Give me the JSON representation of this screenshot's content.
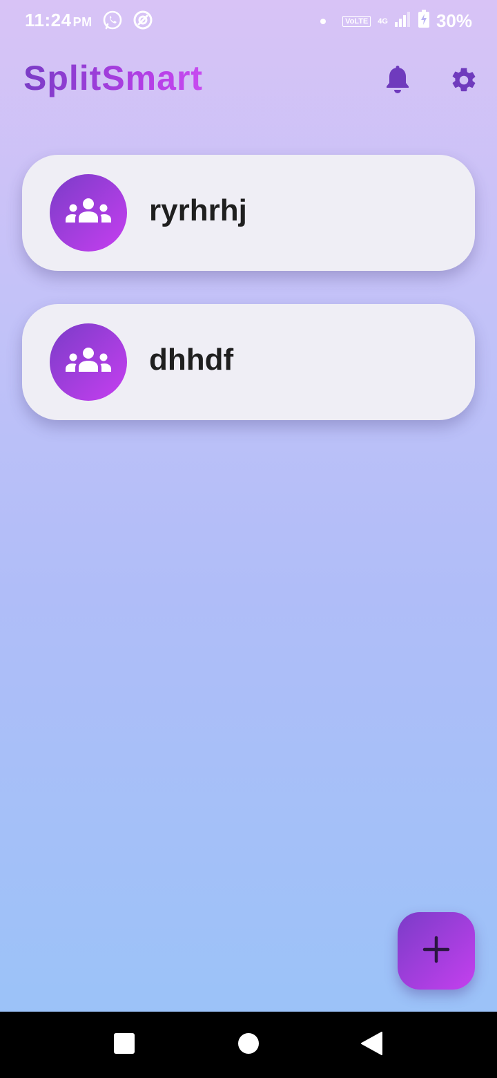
{
  "status_bar": {
    "time": "11:24",
    "ampm": "PM",
    "network_label": "VoLTE",
    "network_type": "4G",
    "battery": "30%",
    "icons": [
      "whatsapp-icon",
      "app-notification-icon",
      "dot-icon",
      "signal-icon",
      "battery-charging-icon"
    ]
  },
  "header": {
    "title": "SplitSmart",
    "icons": [
      "bell-icon",
      "gear-icon"
    ]
  },
  "groups": [
    {
      "name": "ryrhrhj",
      "icon": "group-icon"
    },
    {
      "name": "dhhdf",
      "icon": "group-icon"
    }
  ],
  "fab": {
    "icon": "plus-icon"
  },
  "nav": {
    "icons": [
      "square-recents-icon",
      "circle-home-icon",
      "triangle-back-icon"
    ]
  },
  "colors": {
    "accent_start": "#7b3cc8",
    "accent_end": "#c63ff0",
    "card_bg": "#efeef5",
    "nav_bg": "#000000"
  }
}
